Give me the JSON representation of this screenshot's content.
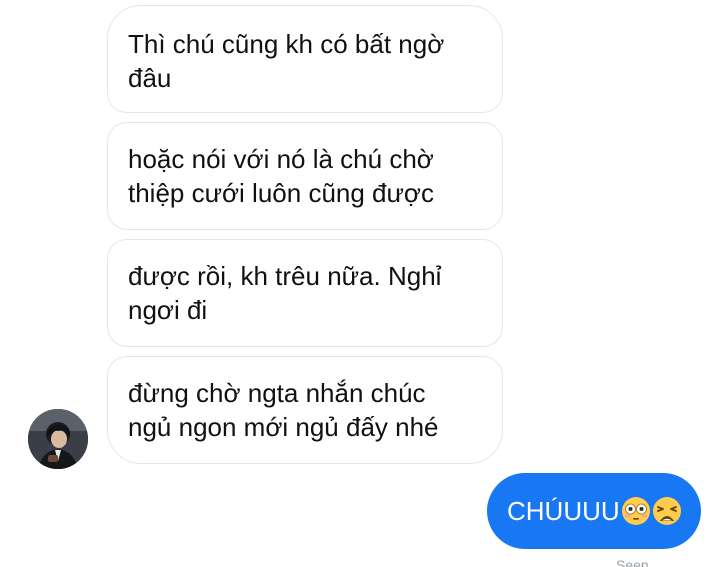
{
  "messages_received": [
    {
      "text": "Thì chú cũng kh có bất ngờ đâu",
      "lines": [
        "Thì chú cũng kh có bất ngờ",
        "đâu"
      ]
    },
    {
      "text": "hoặc nói với nó là chú chờ thiệp cưới luôn cũng được",
      "lines": [
        "hoặc nói với nó là chú chờ",
        "thiệp cưới luôn cũng được"
      ]
    },
    {
      "text": "được rồi, kh trêu nữa. Nghỉ ngơi đi",
      "lines": [
        "được rồi, kh trêu nữa. Nghỉ",
        "ngơi đi"
      ]
    },
    {
      "text": "đừng chờ ngta nhắn chúc ngủ ngon mới ngủ đấy nhé",
      "lines": [
        "đừng chờ ngta nhắn chúc",
        "ngủ ngon mới ngủ đấy nhé"
      ]
    }
  ],
  "message_sent": {
    "text": "CHÚUUU",
    "emojis": [
      "flushed-face-emoji",
      "weary-face-emoji"
    ]
  },
  "status": {
    "seen_label": "Seen"
  },
  "colors": {
    "sent_bubble": "#1877f2",
    "received_border": "#e4e6ea",
    "received_text": "#111111",
    "sent_text": "#ffffff"
  }
}
